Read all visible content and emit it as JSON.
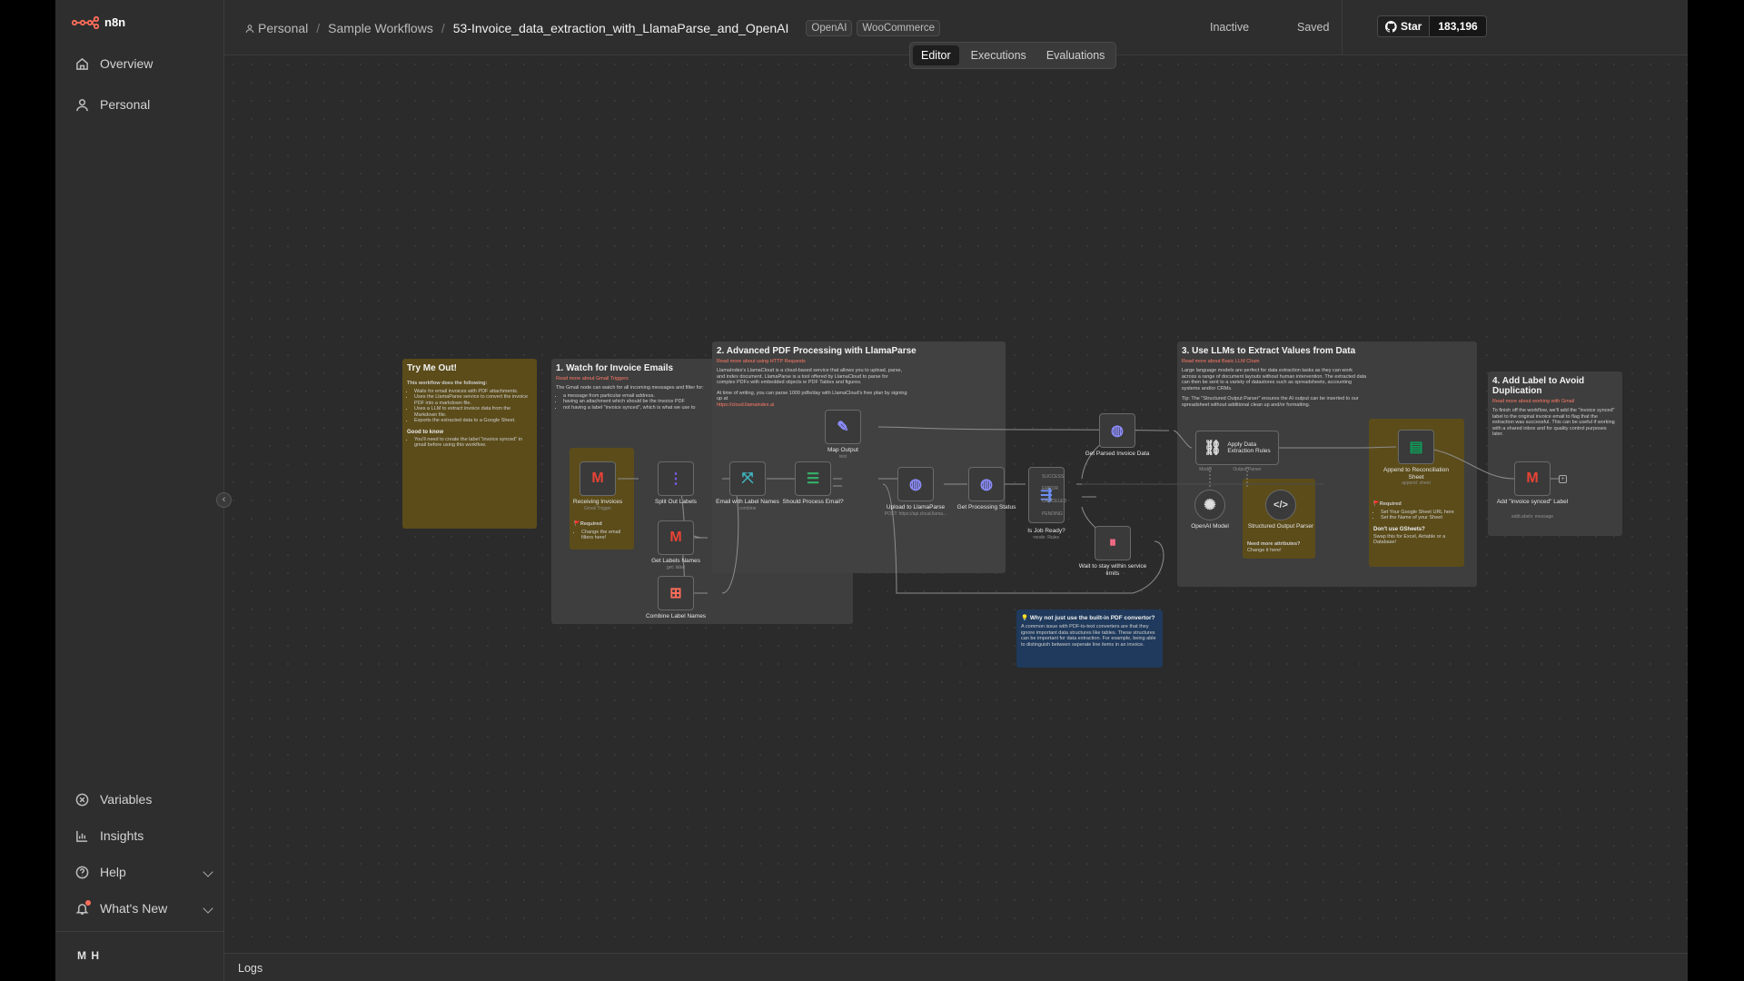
{
  "sidebar": {
    "brand": "n8n",
    "items": [
      {
        "label": "Overview"
      },
      {
        "label": "Personal"
      }
    ],
    "bottom": [
      {
        "label": "Variables"
      },
      {
        "label": "Insights"
      },
      {
        "label": "Help"
      },
      {
        "label": "What's New"
      }
    ],
    "user_initials": "M H"
  },
  "header": {
    "breadcrumbs": [
      "Personal",
      "Sample Workflows",
      "53-Invoice_data_extraction_with_LlamaParse_and_OpenAI"
    ],
    "tags": [
      "OpenAI",
      "WooCommerce"
    ],
    "status_active": "Inactive",
    "status_saved": "Saved",
    "star_label": "Star",
    "star_count": "183,196"
  },
  "tabs": [
    "Editor",
    "Executions",
    "Evaluations"
  ],
  "logs_label": "Logs",
  "notes": {
    "try": {
      "title": "Try Me Out!",
      "intro": "This workflow does the following:",
      "items": [
        "Waits for email invoices with PDF attachments.",
        "Uses the LlamaParse service to convert the invoice PDF into a markdown file.",
        "Uses a LLM to extract invoice data from the Markdown file.",
        "Exports the extracted data to a Google Sheet."
      ],
      "know": "Good to know",
      "know_item": "You'll need to create the label \"invoice synced\" in gmail before using this workflow."
    },
    "watch": {
      "title": "1. Watch for Invoice Emails",
      "link": "Read more about Gmail Triggers",
      "text": "The Gmail node can watch for all incoming messages and filter for:",
      "items": [
        "a message from particular email address.",
        "having an attachment which should be the invoice PDF",
        "not having a label \"invoice synced\", which is what we use to"
      ]
    },
    "llama": {
      "title": "2. Advanced PDF Processing with LlamaParse",
      "link": "Read more about using HTTP Requests",
      "text1": "LlamaIndex's LlamaCloud is a cloud-based service that allows you to upload, parse, and index document. LlamaParse is a tool offered by LlamaCloud to parse for complex PDFs with embedded objects ie PDF Tables and figures.",
      "text2": "At time of writing, you can parse 1000 pdfs/day with LlamaCloud's free plan by signing up at",
      "url": "https://cloud.llamaindex.ai"
    },
    "llm": {
      "title": "3. Use LLMs to Extract Values from Data",
      "link": "Read more about Basic LLM Chain",
      "text1": "Large language models are perfect for data extraction tasks as they can work across a range of document layouts without human intervention. The extracted data can then be sent to a variety of datastores such as spreadsheets, accounting systems and/or CRMs.",
      "text2": "Tip: The \"Structured Output Parser\" ensures the AI output can be inserted to our spreadsheet without additional clean up and/or formatting."
    },
    "label": {
      "title": "4. Add Label to Avoid Duplication",
      "link": "Read more about working with Gmail",
      "text": "To finish off the workflow, we'll add the \"invoice synced\" label to the original invoice email to flag that the extraction was successful. This can be useful if working with a shared inbox and for quality control purposes later."
    },
    "why": {
      "title": "💡 Why not just use the built-in PDF convertor?",
      "text": "A common issue with PDF-to-text converters are that they ignore important data structures like tables. These structures can be important for data extraction. For example, being able to distinguish between seperate line items in an invoice."
    },
    "req1": {
      "title": "🚩Required",
      "item": "Change the email filters here!"
    },
    "need": {
      "title": "Need more attributes?",
      "text": "Change it here!"
    },
    "req2": {
      "title": "🚩Required",
      "items": [
        "Set Your Google Sheet URL here",
        "Set the Name of your Sheet"
      ],
      "alt_title": "Don't use GSheets?",
      "alt_text": "Swap this for Excel, Airtable or a Database!"
    }
  },
  "nodes": [
    {
      "id": "receiving",
      "label": "Receiving Invoices",
      "sub": "Gmail Trigger",
      "icon": "gmail-icon"
    },
    {
      "id": "split",
      "label": "Split Out Labels",
      "sub": "",
      "icon": "split-icon"
    },
    {
      "id": "getlabels",
      "label": "Get Labels Names",
      "sub": "get: label",
      "icon": "gmail-icon"
    },
    {
      "id": "combine",
      "label": "Combine Label Names",
      "sub": "",
      "icon": "combine-icon"
    },
    {
      "id": "merge",
      "label": "Email with Label Names",
      "sub": "combine",
      "icon": "merge-icon"
    },
    {
      "id": "should",
      "label": "Should Process Email?",
      "sub": "",
      "icon": "filter-icon"
    },
    {
      "id": "map",
      "label": "Map Output",
      "sub": "test",
      "icon": "pencil-icon"
    },
    {
      "id": "upload",
      "label": "Upload to LlamaParse",
      "sub": "POST: https://api.cloud.llama...",
      "icon": "globe-icon"
    },
    {
      "id": "status",
      "label": "Get Processing Status",
      "sub": "",
      "icon": "globe-icon"
    },
    {
      "id": "isready",
      "label": "Is Job Ready?",
      "sub": "mode: Rules",
      "icon": "switch-icon"
    },
    {
      "id": "wait",
      "label": "Wait to stay within service limits",
      "sub": "",
      "icon": "pause-icon"
    },
    {
      "id": "parsed",
      "label": "Get Parsed Invoice Data",
      "sub": "",
      "icon": "globe-icon"
    },
    {
      "id": "apply",
      "label": "Apply Data Extraction Rules",
      "sub": "",
      "icon": "link-icon"
    },
    {
      "id": "openai",
      "label": "OpenAI Model",
      "sub": "",
      "icon": "openai-icon"
    },
    {
      "id": "parser",
      "label": "Structured Output Parser",
      "sub": "",
      "icon": "code-icon"
    },
    {
      "id": "append",
      "label": "Append to Reconciliation Sheet",
      "sub": "append: sheet",
      "icon": "sheets-icon"
    },
    {
      "id": "addlabel",
      "label": "Add \"invoice synced\" Label",
      "sub": "addLabels: message",
      "icon": "gmail-icon"
    }
  ],
  "switch_outputs": [
    "SUCCESS",
    "ERROR",
    "CANCELED",
    "PENDING"
  ],
  "port_labels": [
    "Model",
    "Output Parser"
  ],
  "colors": {
    "accent": "#ff6d5a",
    "canvas": "#2b2b2b",
    "note_yellow": "#5b4c1a",
    "note_blue": "#1f3a5c"
  }
}
